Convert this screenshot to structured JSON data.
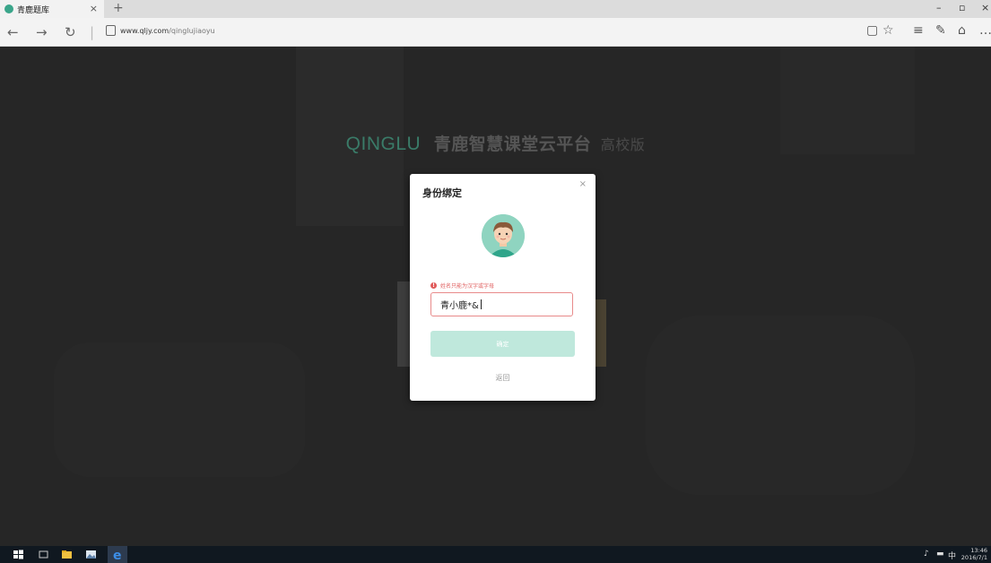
{
  "browser": {
    "tab_title": "青鹿题库",
    "tab_close": "×",
    "new_tab": "+",
    "url_domain": "www.qljy.com",
    "url_path": "/qinglujiaoyu",
    "window_controls": {
      "minimize": "–",
      "maximize": "▫",
      "close": "×"
    }
  },
  "page": {
    "brand_en": "QINGLU",
    "brand_zh": "青鹿智慧课堂云平台",
    "brand_edition": "高校版"
  },
  "dialog": {
    "title": "身份绑定",
    "close": "×",
    "error_icon": "!",
    "error_message": "姓名只能为汉字或字母",
    "name_value": "青小鹿*&",
    "confirm_label": "确定",
    "back_label": "返回"
  },
  "taskbar": {
    "ime": "中",
    "time": "13:46",
    "date": "2016/7/1"
  },
  "colors": {
    "accent": "#3aa58a",
    "error": "#e05a5a",
    "button_disabled": "#bfe8dc"
  }
}
